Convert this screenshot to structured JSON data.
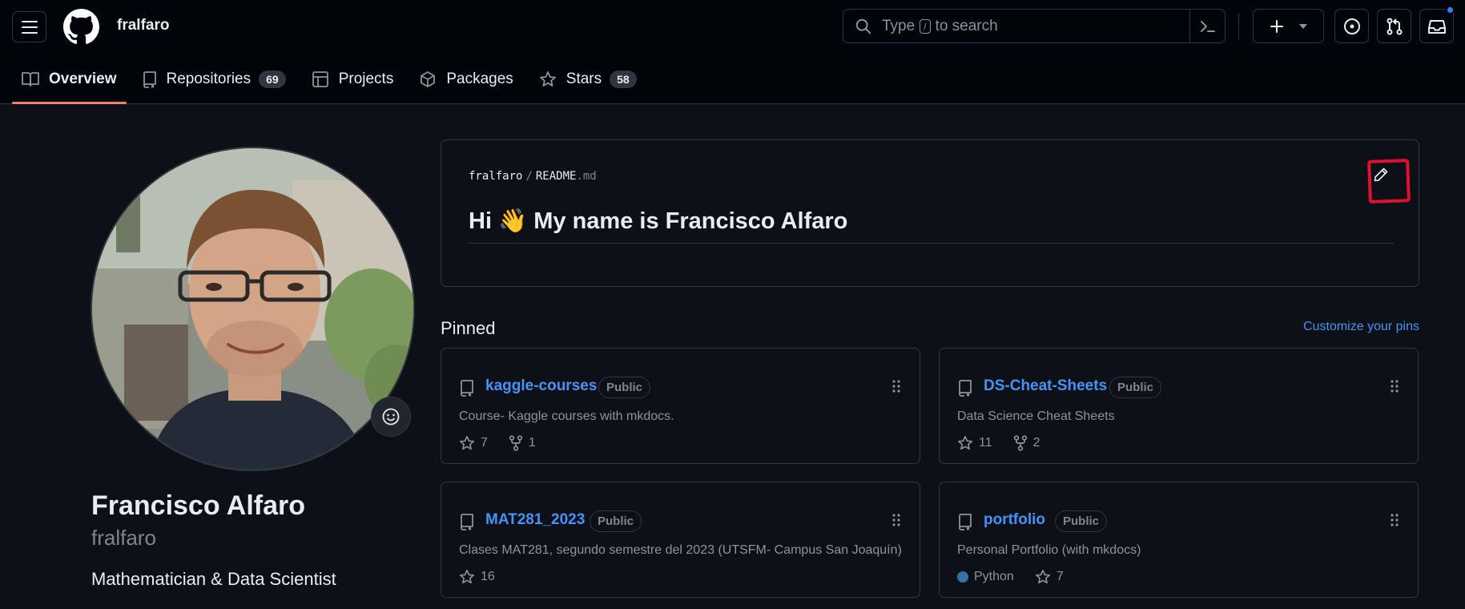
{
  "header": {
    "username": "fralfaro",
    "search": {
      "before": "Type",
      "key": "/",
      "after": "to search"
    }
  },
  "tabs": [
    {
      "label": "Overview",
      "active": true
    },
    {
      "label": "Repositories",
      "count": "69"
    },
    {
      "label": "Projects"
    },
    {
      "label": "Packages"
    },
    {
      "label": "Stars",
      "count": "58"
    }
  ],
  "profile": {
    "name": "Francisco Alfaro",
    "login": "fralfaro",
    "bio": "Mathematician & Data Scientist"
  },
  "readme": {
    "owner": "fralfaro",
    "separator": "/",
    "file": "README",
    "ext": ".md",
    "heading_pre": "Hi",
    "heading_emoji": "👋",
    "heading_post": "My name is Francisco Alfaro"
  },
  "pinned": {
    "title": "Pinned",
    "customize": "Customize your pins",
    "repos": [
      {
        "name": "kaggle-courses",
        "visibility": "Public",
        "description": "Course- Kaggle courses with mkdocs.",
        "stars": "7",
        "forks": "1"
      },
      {
        "name": "DS-Cheat-Sheets",
        "visibility": "Public",
        "description": "Data Science Cheat Sheets",
        "stars": "11",
        "forks": "2"
      },
      {
        "name": "MAT281_2023",
        "visibility": "Public",
        "description": "Clases MAT281, segundo semestre del 2023 (UTSFM- Campus San Joaquín)",
        "stars": "16"
      },
      {
        "name": "portfolio",
        "visibility": "Public",
        "description": "Personal Portfolio (with mkdocs)",
        "language": "Python",
        "language_color": "#3572A5",
        "stars": "7"
      }
    ]
  },
  "colors": {
    "accent": "#4493f8",
    "tab_underline": "#f78166",
    "annotation": "#e01030"
  }
}
